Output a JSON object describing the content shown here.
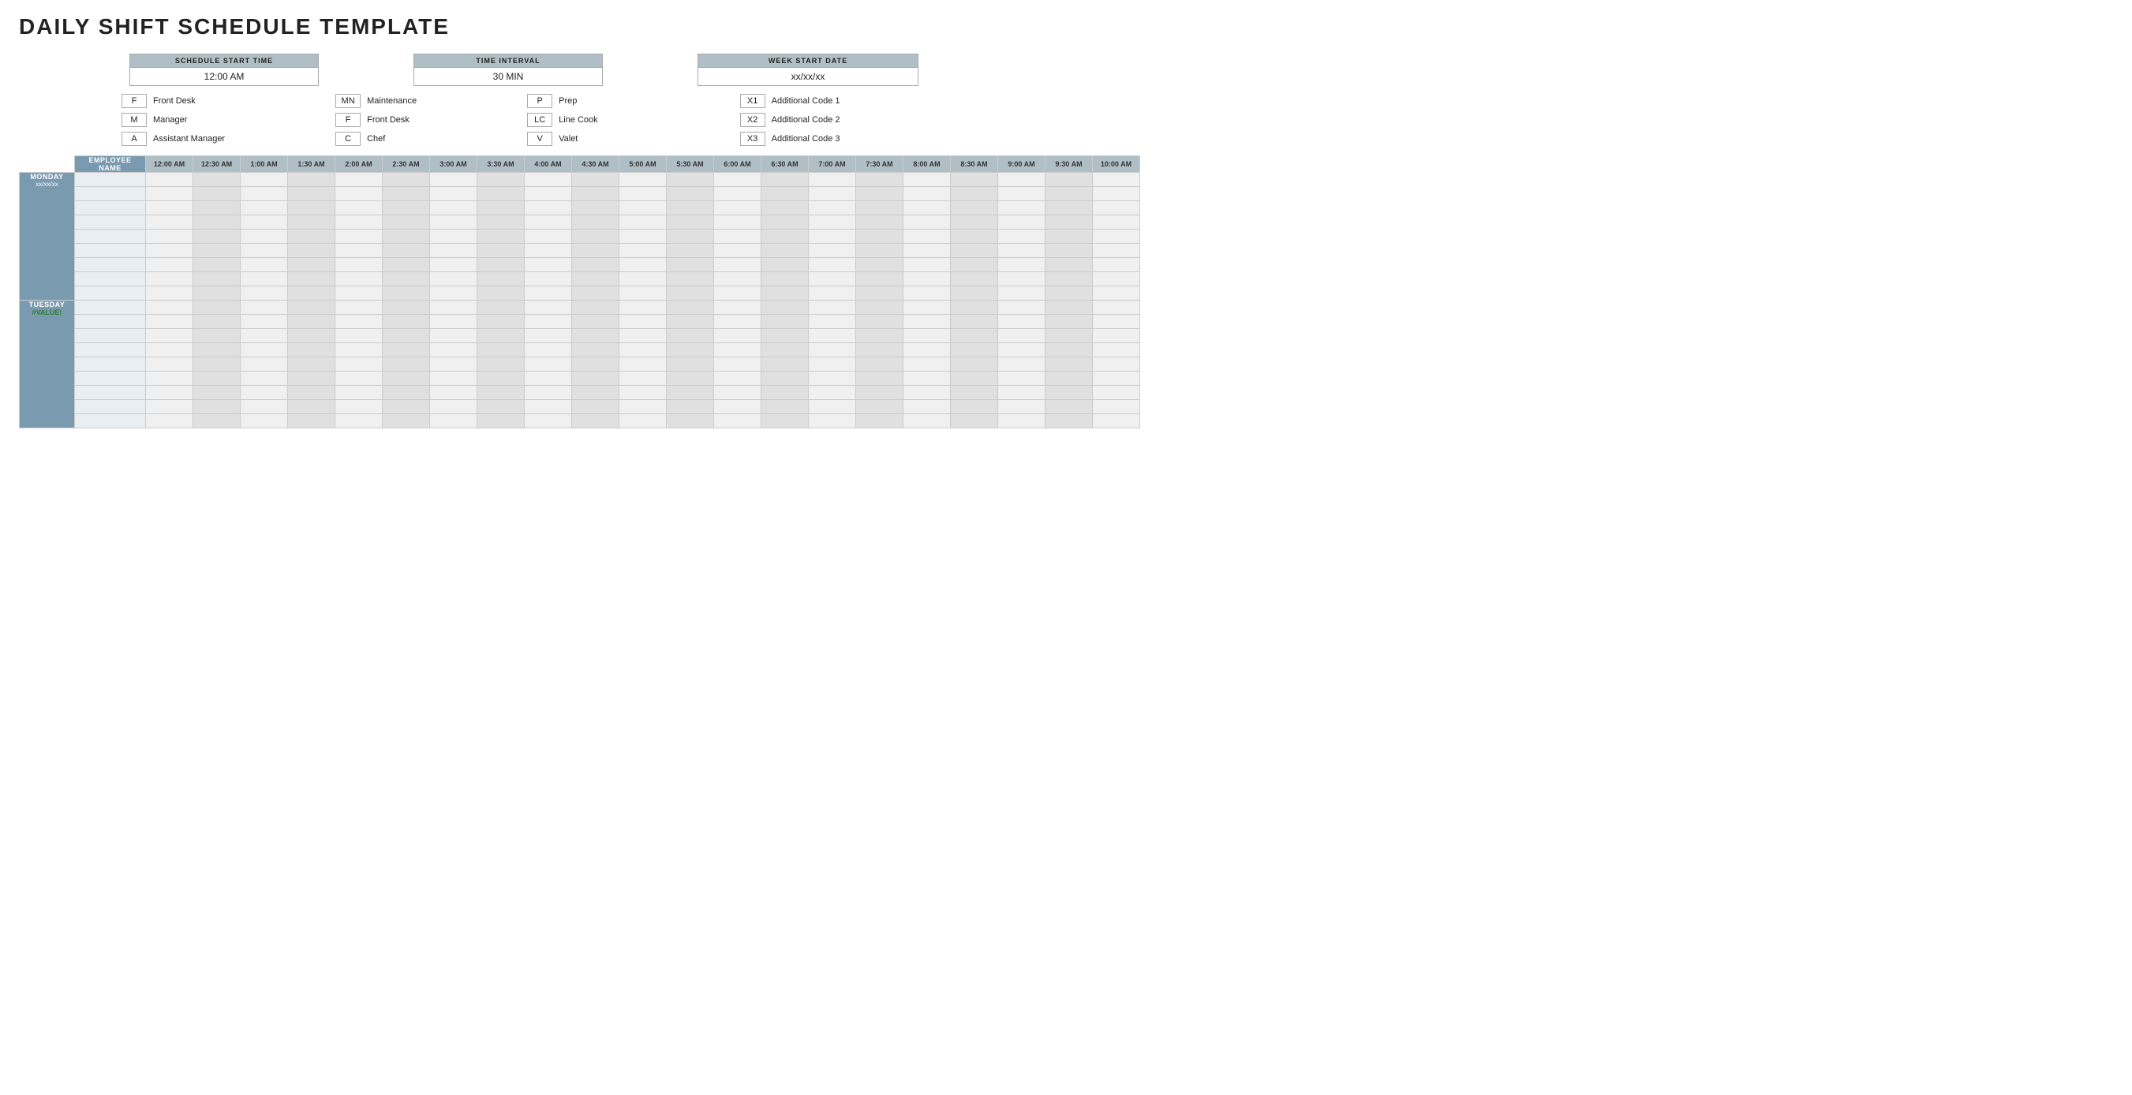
{
  "title": "DAILY SHIFT SCHEDULE TEMPLATE",
  "controls": [
    {
      "id": "schedule-start",
      "label": "SCHEDULE START TIME",
      "value": "12:00 AM"
    },
    {
      "id": "time-interval",
      "label": "TIME INTERVAL",
      "value": "30 MIN"
    },
    {
      "id": "week-start",
      "label": "WEEK START DATE",
      "value": "xx/xx/xx"
    }
  ],
  "legend": [
    [
      {
        "code": "F",
        "name": "Front Desk"
      },
      {
        "code": "M",
        "name": "Manager"
      },
      {
        "code": "A",
        "name": "Assistant Manager"
      }
    ],
    [
      {
        "code": "MN",
        "name": "Maintenance"
      },
      {
        "code": "F",
        "name": "Front Desk"
      },
      {
        "code": "C",
        "name": "Chef"
      }
    ],
    [
      {
        "code": "P",
        "name": "Prep"
      },
      {
        "code": "LC",
        "name": "Line Cook"
      },
      {
        "code": "V",
        "name": "Valet"
      }
    ],
    [
      {
        "code": "X1",
        "name": "Additional Code 1"
      },
      {
        "code": "X2",
        "name": "Additional Code 2"
      },
      {
        "code": "X3",
        "name": "Additional Code 3"
      }
    ]
  ],
  "time_columns": [
    "12:00 AM",
    "12:30 AM",
    "1:00 AM",
    "1:30 AM",
    "2:00 AM",
    "2:30 AM",
    "3:00 AM",
    "3:30 AM",
    "4:00 AM",
    "4:30 AM",
    "5:00 AM",
    "5:30 AM",
    "6:00 AM",
    "6:30 AM",
    "7:00 AM",
    "7:30 AM",
    "8:00 AM",
    "8:30 AM",
    "9:00 AM",
    "9:30 AM",
    "10:00 AM"
  ],
  "days": [
    {
      "name": "MONDAY",
      "date": "xx/xx/xx",
      "rows": 9
    },
    {
      "name": "TUESDAY",
      "date": "#VALUE!",
      "date_class": "error",
      "rows": 9
    }
  ],
  "employee_header": "EMPLOYEE\nNAME"
}
